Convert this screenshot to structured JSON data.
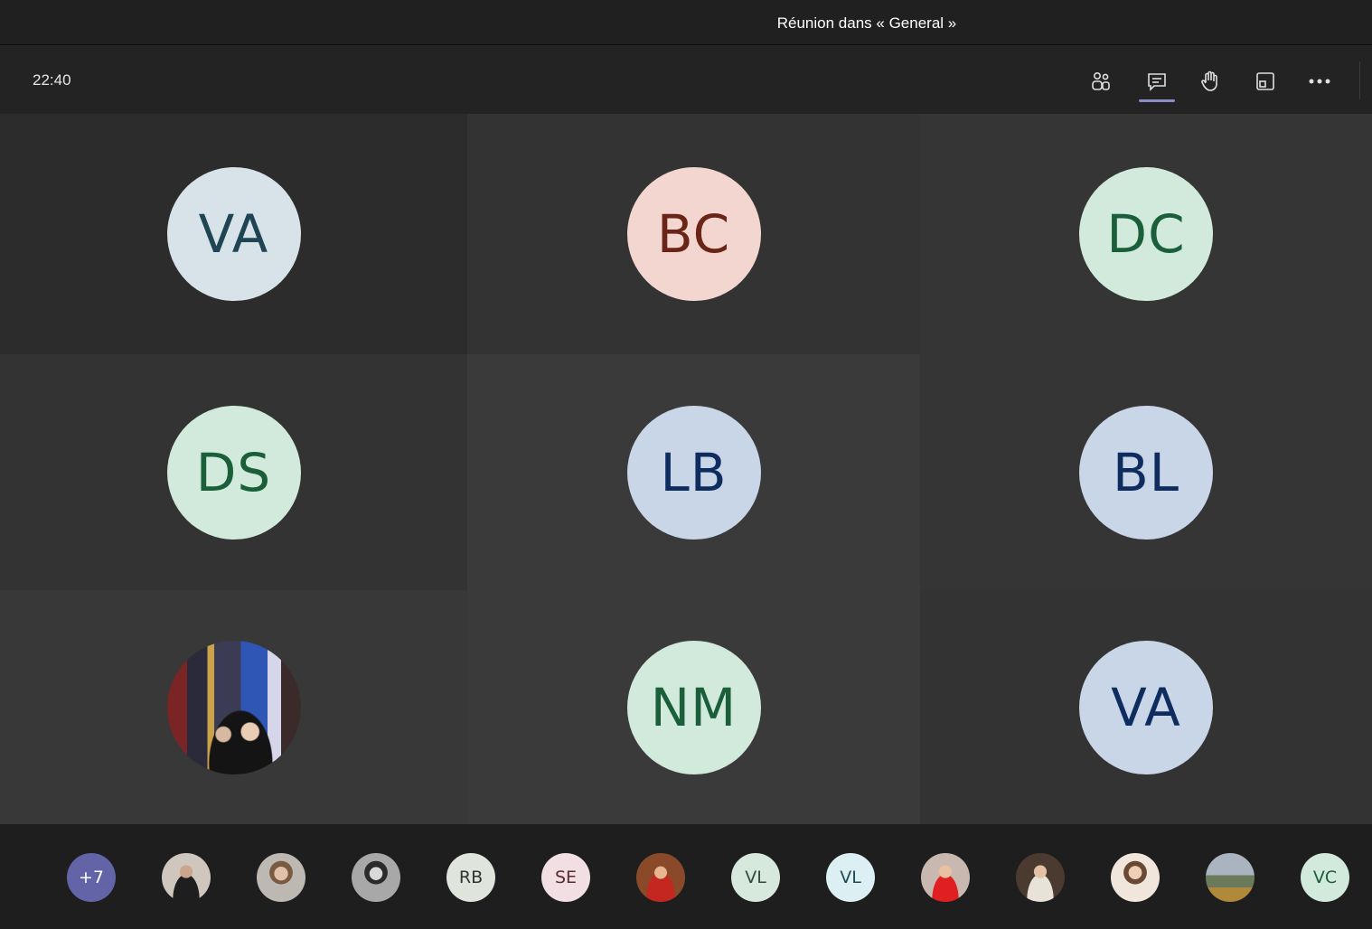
{
  "window": {
    "title": "Réunion dans « General »"
  },
  "toolbar": {
    "clock": "22:40",
    "buttons": [
      {
        "name": "participants",
        "icon": "people-icon"
      },
      {
        "name": "chat",
        "icon": "chat-icon",
        "active": true
      },
      {
        "name": "raise-hand",
        "icon": "hand-icon"
      },
      {
        "name": "rooms",
        "icon": "window-icon"
      },
      {
        "name": "more",
        "icon": "more-icon"
      }
    ]
  },
  "grid": {
    "tiles": [
      {
        "initials": "VA",
        "bg": "#d8e3e9",
        "fg": "#1f4454",
        "tile_bg": "#2c2c2c"
      },
      {
        "initials": "BC",
        "bg": "#f3d6cf",
        "fg": "#6b2418",
        "tile_bg": "#333333"
      },
      {
        "initials": "DC",
        "bg": "#d1eadb",
        "fg": "#1b5e3a",
        "tile_bg": "#353535"
      },
      {
        "initials": "DS",
        "bg": "#d1eadb",
        "fg": "#1b5e3a",
        "tile_bg": "#333333"
      },
      {
        "initials": "LB",
        "bg": "#c9d6e8",
        "fg": "#0e2c5e",
        "tile_bg": "#3a3a3a"
      },
      {
        "initials": "BL",
        "bg": "#c9d6e8",
        "fg": "#0e2c5e",
        "tile_bg": "#353535"
      },
      {
        "initials": "",
        "photo": true,
        "tile_bg": "#383838"
      },
      {
        "initials": "NM",
        "bg": "#d1eadb",
        "fg": "#1b5e3a",
        "tile_bg": "#3a3a3a"
      },
      {
        "initials": "VA",
        "bg": "#c9d6e8",
        "fg": "#0e2c5e",
        "tile_bg": "#333333"
      }
    ]
  },
  "roster": [
    {
      "label": "+7",
      "bg": "#6264a7",
      "fg": "#ffffff"
    },
    {
      "label": "",
      "photo": true
    },
    {
      "label": "",
      "photo": true
    },
    {
      "label": "",
      "photo": true
    },
    {
      "label": "RB",
      "bg": "#dfe5dc",
      "fg": "#333333"
    },
    {
      "label": "SE",
      "bg": "#f1dfe3",
      "fg": "#5a2a33"
    },
    {
      "label": "",
      "photo": true
    },
    {
      "label": "VL",
      "bg": "#d7e8dc",
      "fg": "#2d4d37"
    },
    {
      "label": "VL",
      "bg": "#dceff2",
      "fg": "#214a55"
    },
    {
      "label": "",
      "photo": true
    },
    {
      "label": "",
      "photo": true
    },
    {
      "label": "",
      "photo": true
    },
    {
      "label": "",
      "photo": true
    },
    {
      "label": "VC",
      "bg": "#d1eadb",
      "fg": "#1b5e3a"
    }
  ]
}
